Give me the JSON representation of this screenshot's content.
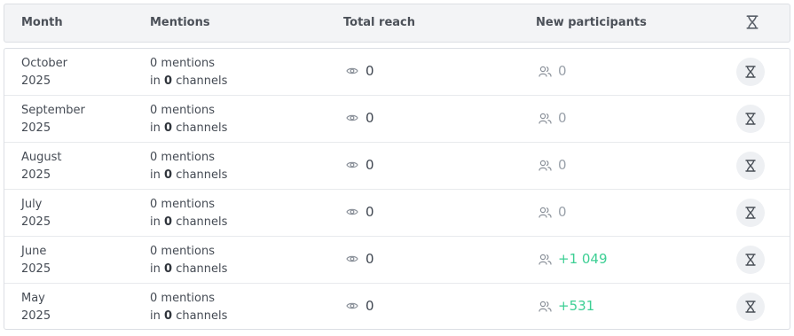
{
  "header": {
    "month": "Month",
    "mentions": "Mentions",
    "reach": "Total reach",
    "participants": "New participants",
    "action_icon": "hourglass-icon"
  },
  "colors": {
    "positive": "#3dcf94",
    "neutral": "#9aa1aa",
    "icon": "#8a9099"
  },
  "rows": [
    {
      "month": "October",
      "year": "2025",
      "mentions": "0 mentions",
      "in": "in",
      "channels_count": "0",
      "channels": "channels",
      "reach": "0",
      "participants": "0",
      "positive": false
    },
    {
      "month": "September",
      "year": "2025",
      "mentions": "0 mentions",
      "in": "in",
      "channels_count": "0",
      "channels": "channels",
      "reach": "0",
      "participants": "0",
      "positive": false
    },
    {
      "month": "August",
      "year": "2025",
      "mentions": "0 mentions",
      "in": "in",
      "channels_count": "0",
      "channels": "channels",
      "reach": "0",
      "participants": "0",
      "positive": false
    },
    {
      "month": "July",
      "year": "2025",
      "mentions": "0 mentions",
      "in": "in",
      "channels_count": "0",
      "channels": "channels",
      "reach": "0",
      "participants": "0",
      "positive": false
    },
    {
      "month": "June",
      "year": "2025",
      "mentions": "0 mentions",
      "in": "in",
      "channels_count": "0",
      "channels": "channels",
      "reach": "0",
      "participants": "+1 049",
      "positive": true
    },
    {
      "month": "May",
      "year": "2025",
      "mentions": "0 mentions",
      "in": "in",
      "channels_count": "0",
      "channels": "channels",
      "reach": "0",
      "participants": "+531",
      "positive": true
    }
  ]
}
